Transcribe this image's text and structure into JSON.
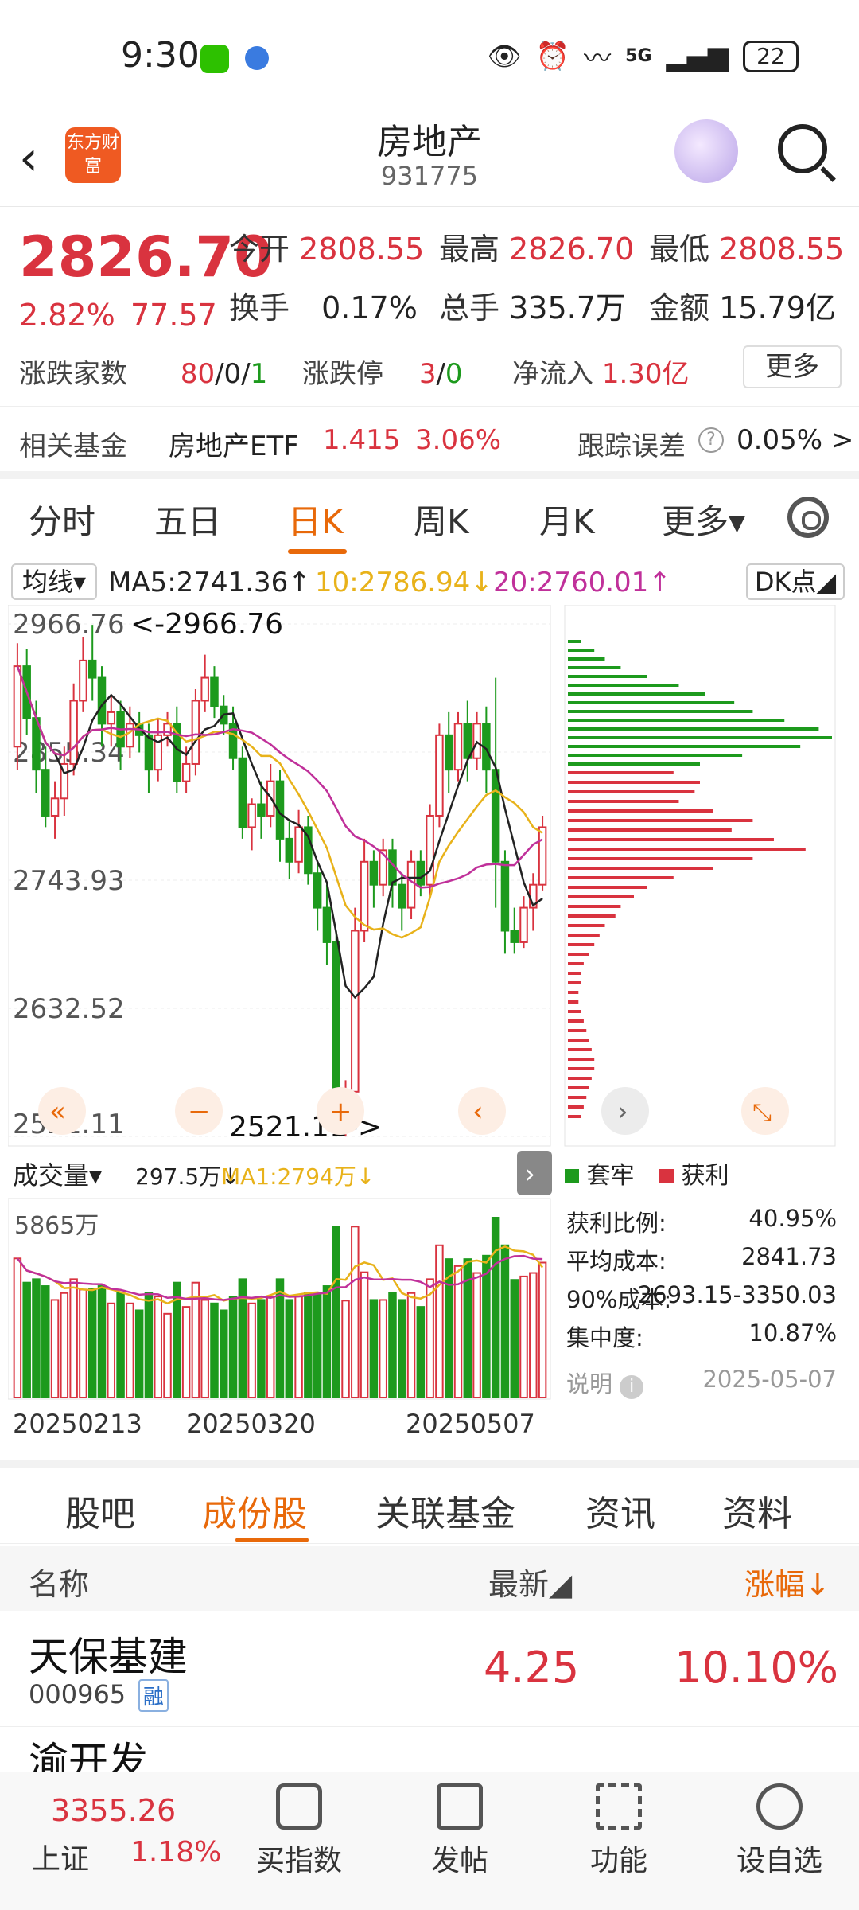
{
  "status_bar": {
    "time": "9:30",
    "battery": "22",
    "network": "5G"
  },
  "header": {
    "title": "房地产",
    "code": "931775",
    "logo_text": "东方财富"
  },
  "quote": {
    "price": "2826.70",
    "change_pct": "2.82%",
    "change_val": "77.57",
    "open_label": "今开",
    "open": "2808.55",
    "high_label": "最高",
    "high": "2826.70",
    "low_label": "最低",
    "low": "2808.55",
    "turnover_label": "换手",
    "turnover": "0.17%",
    "volume_label": "总手",
    "volume": "335.7万",
    "amount_label": "金额",
    "amount": "15.79亿",
    "breadth_label": "涨跌家数",
    "breadth_up": "80",
    "breadth_flat": "0",
    "breadth_down": "1",
    "breadth_sep": "/",
    "limit_label": "涨跌停",
    "limit_up": "3",
    "limit_down": "0",
    "netflow_label": "净流入",
    "netflow": "1.30亿",
    "more": "更多",
    "fund_label": "相关基金",
    "fund_name": "房地产ETF",
    "fund_price": "1.415",
    "fund_pct": "3.06%",
    "tracking_label": "跟踪误差",
    "tracking_val": "0.05% >"
  },
  "tabs": [
    "分时",
    "五日",
    "日K",
    "周K",
    "月K",
    "更多▾"
  ],
  "active_tab": "日K",
  "ma": {
    "selector": "均线▾",
    "ma5": "MA5:2741.36↑",
    "ma10": "10:2786.94↓",
    "ma20": "20:2760.01↑",
    "dk": "DK点◢",
    "colors": {
      "ma5": "#222222",
      "ma10": "#e8b21a",
      "ma20": "#c0309a"
    }
  },
  "chart_data": {
    "type": "candlestick",
    "y_ticks": [
      "2966.76",
      "2855.34",
      "2743.93",
      "2632.52",
      "2521.11"
    ],
    "high_marker": "<-2966.76",
    "low_marker": "2521.11->",
    "ylim": [
      2521.11,
      2966.76
    ],
    "candles": [
      [
        2860,
        2930,
        2840,
        2950
      ],
      [
        2930,
        2885,
        2870,
        2945
      ],
      [
        2885,
        2840,
        2820,
        2900
      ],
      [
        2840,
        2800,
        2790,
        2860
      ],
      [
        2800,
        2815,
        2780,
        2830
      ],
      [
        2815,
        2845,
        2800,
        2860
      ],
      [
        2845,
        2900,
        2835,
        2915
      ],
      [
        2900,
        2935,
        2890,
        2955
      ],
      [
        2935,
        2920,
        2900,
        2966
      ],
      [
        2920,
        2880,
        2860,
        2930
      ],
      [
        2880,
        2890,
        2860,
        2905
      ],
      [
        2890,
        2860,
        2840,
        2900
      ],
      [
        2860,
        2880,
        2850,
        2895
      ],
      [
        2880,
        2870,
        2855,
        2890
      ],
      [
        2870,
        2840,
        2820,
        2880
      ],
      [
        2840,
        2870,
        2830,
        2885
      ],
      [
        2870,
        2880,
        2860,
        2890
      ],
      [
        2880,
        2830,
        2820,
        2895
      ],
      [
        2830,
        2845,
        2820,
        2860
      ],
      [
        2845,
        2900,
        2835,
        2910
      ],
      [
        2900,
        2920,
        2890,
        2940
      ],
      [
        2920,
        2895,
        2885,
        2930
      ],
      [
        2895,
        2880,
        2870,
        2905
      ],
      [
        2880,
        2850,
        2840,
        2895
      ],
      [
        2850,
        2790,
        2780,
        2860
      ],
      [
        2790,
        2810,
        2770,
        2815
      ],
      [
        2810,
        2800,
        2780,
        2830
      ],
      [
        2800,
        2830,
        2790,
        2845
      ],
      [
        2830,
        2780,
        2760,
        2840
      ],
      [
        2780,
        2760,
        2745,
        2795
      ],
      [
        2760,
        2790,
        2750,
        2805
      ],
      [
        2790,
        2750,
        2740,
        2800
      ],
      [
        2750,
        2720,
        2700,
        2760
      ],
      [
        2720,
        2690,
        2670,
        2740
      ],
      [
        2690,
        2540,
        2521,
        2700
      ],
      [
        2540,
        2560,
        2521,
        2570
      ],
      [
        2560,
        2700,
        2555,
        2720
      ],
      [
        2700,
        2760,
        2690,
        2780
      ],
      [
        2760,
        2740,
        2720,
        2770
      ],
      [
        2740,
        2770,
        2730,
        2780
      ],
      [
        2770,
        2740,
        2720,
        2780
      ],
      [
        2740,
        2720,
        2700,
        2750
      ],
      [
        2720,
        2760,
        2710,
        2770
      ],
      [
        2760,
        2740,
        2730,
        2770
      ],
      [
        2740,
        2800,
        2730,
        2810
      ],
      [
        2800,
        2870,
        2790,
        2880
      ],
      [
        2870,
        2840,
        2820,
        2890
      ],
      [
        2840,
        2880,
        2830,
        2890
      ],
      [
        2880,
        2850,
        2830,
        2900
      ],
      [
        2850,
        2880,
        2840,
        2890
      ],
      [
        2880,
        2840,
        2820,
        2895
      ],
      [
        2840,
        2760,
        2720,
        2920
      ],
      [
        2760,
        2700,
        2680,
        2770
      ],
      [
        2700,
        2690,
        2680,
        2720
      ],
      [
        2690,
        2720,
        2685,
        2730
      ],
      [
        2720,
        2740,
        2700,
        2750
      ],
      [
        2740,
        2790,
        2735,
        2800
      ]
    ],
    "volume_label": "成交量▾",
    "volume_now": "297.5万↓",
    "vol_ma": "MA1:2794万↓",
    "vol_ymax": "5865万",
    "dates": [
      "20250213",
      "20250320",
      "20250507"
    ],
    "profile_legend": [
      "套牢",
      "获利"
    ],
    "profile_green": [
      0.05,
      0.1,
      0.14,
      0.2,
      0.3,
      0.42,
      0.52,
      0.63,
      0.7,
      0.82,
      0.95,
      1.0,
      0.88,
      0.66,
      0.5
    ],
    "profile_red": [
      0.4,
      0.5,
      0.48,
      0.42,
      0.55,
      0.7,
      0.62,
      0.78,
      0.9,
      0.7,
      0.55,
      0.4,
      0.3,
      0.25,
      0.2,
      0.18,
      0.14,
      0.12,
      0.1,
      0.08,
      0.06,
      0.05,
      0.05,
      0.04,
      0.04,
      0.05,
      0.06,
      0.07,
      0.08,
      0.09,
      0.1,
      0.1,
      0.09,
      0.08,
      0.07,
      0.06,
      0.05
    ]
  },
  "chip_stats": {
    "profit_label": "获利比例:",
    "profit": "40.95%",
    "avg_label": "平均成本:",
    "avg": "2841.73",
    "range_label": "90%成本:",
    "range": "2693.15-3350.03",
    "conc_label": "集中度:",
    "conc": "10.87%",
    "note_label": "说明",
    "note_date": "2025-05-07"
  },
  "bottom_tabs": [
    "股吧",
    "成份股",
    "关联基金",
    "资讯",
    "资料"
  ],
  "table": {
    "col_name": "名称",
    "col_latest": "最新◢",
    "col_change": "涨幅↓",
    "rows": [
      {
        "name": "天保基建",
        "code": "000965",
        "tag": "融",
        "price": "4.25",
        "pct": "10.10%"
      }
    ],
    "next_row_name": "渝开发"
  },
  "bottom_bar": {
    "index_price": "3355.26",
    "index_name": "上证",
    "index_pct": "1.18%",
    "items": [
      "买指数",
      "发帖",
      "功能",
      "设自选"
    ]
  }
}
